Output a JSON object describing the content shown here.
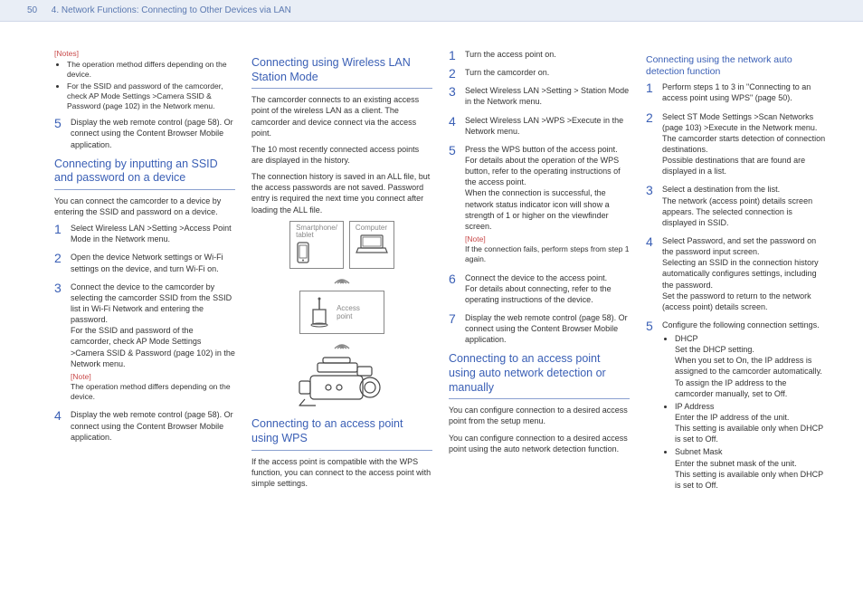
{
  "header": {
    "page_number": "50",
    "title": "4. Network Functions: Connecting to Other Devices via LAN"
  },
  "col1": {
    "notes_label": "[Notes]",
    "notes": [
      "The operation method differs depending on the device.",
      "For the SSID and password of the camcorder, check AP Mode Settings >Camera SSID & Password (page 102) in the Network menu."
    ],
    "step5_prefix": {
      "num": "5",
      "text": "Display the web remote control (page 58). Or connect using the Content Browser Mobile application."
    },
    "section_a_title": "Connecting by inputting an SSID and password on a device",
    "section_a_intro": "You can connect the camcorder to a device by entering the SSID and password on a device.",
    "section_a_steps": [
      {
        "num": "1",
        "text": "Select Wireless LAN >Setting >Access Point Mode in the Network menu."
      },
      {
        "num": "2",
        "text": "Open the device Network settings or Wi-Fi settings on the device, and turn Wi-Fi on."
      },
      {
        "num": "3",
        "text": "Connect the device to the camcorder by selecting the camcorder SSID from the SSID list in Wi-Fi Network and entering the password.\nFor the SSID and password of the camcorder, check AP Mode Settings >Camera SSID & Password (page 102) in the Network menu.",
        "note_label": "[Note]",
        "note": "The operation method differs depending on the device."
      },
      {
        "num": "4",
        "text": "Display the web remote control (page 58). Or connect using the Content Browser Mobile application."
      }
    ]
  },
  "col2": {
    "section_b_title": "Connecting using Wireless LAN Station Mode",
    "section_b_body1": "The camcorder connects to an existing access point of the wireless LAN as a client. The camcorder and device connect via the access point.",
    "section_b_body2": "The 10 most recently connected access points are displayed in the history.",
    "section_b_body3": "The connection history is saved in an ALL file, but the access passwords are not saved. Password entry is required the next time you connect after loading the ALL file.",
    "diagram": {
      "tablet_label": "Smartphone/\ntablet",
      "computer_label": "Computer",
      "ap_label": "Access\npoint"
    },
    "section_c_title": "Connecting to an access point using WPS",
    "section_c_body": "If the access point is compatible with the WPS function, you can connect to the access point with simple settings."
  },
  "col3": {
    "wps_steps": [
      {
        "num": "1",
        "text": "Turn the access point on."
      },
      {
        "num": "2",
        "text": "Turn the camcorder on."
      },
      {
        "num": "3",
        "text": "Select Wireless LAN >Setting > Station Mode in the Network menu."
      },
      {
        "num": "4",
        "text": "Select Wireless LAN >WPS >Execute in the Network menu."
      },
      {
        "num": "5",
        "text": "Press the WPS button of the access point.\nFor details about the operation of the WPS button, refer to the operating instructions of the access point.\nWhen the connection is successful, the network status indicator icon will show a strength of 1 or higher on the viewfinder screen.",
        "note_label": "[Note]",
        "note": "If the connection fails, perform steps from step 1 again."
      },
      {
        "num": "6",
        "text": "Connect the device to the access point.\nFor details about connecting, refer to the operating instructions of the device."
      },
      {
        "num": "7",
        "text": "Display the web remote control (page 58). Or connect using the Content Browser Mobile application."
      }
    ],
    "section_d_title": "Connecting to an access point using auto network detection or manually",
    "section_d_body1": "You can configure connection to a desired access point from the setup menu.",
    "section_d_body2": "You can configure connection to a desired access point using the auto network detection function."
  },
  "col4": {
    "section_e_title": "Connecting using the network auto detection function",
    "auto_steps": [
      {
        "num": "1",
        "text": "Perform steps 1 to 3 in \"Connecting to an access point using WPS\" (page 50)."
      },
      {
        "num": "2",
        "text": "Select ST Mode Settings >Scan Networks (page 103) >Execute in the Network menu.\nThe camcorder starts detection of connection destinations.\nPossible destinations that are found are displayed in a list."
      },
      {
        "num": "3",
        "text": "Select a destination from the list.\nThe network (access point) details screen appears. The selected connection is displayed in SSID."
      },
      {
        "num": "4",
        "text": "Select Password, and set the password on the password input screen.\nSelecting an SSID in the connection history automatically configures settings, including the password.\nSet the password to return to the network (access point) details screen."
      },
      {
        "num": "5",
        "text": "Configure the following connection settings.",
        "bullets": [
          {
            "title": "DHCP",
            "body": "Set the DHCP setting.\nWhen you set to On, the IP address is assigned to the camcorder automatically.\nTo assign the IP address to the camcorder manually, set to Off."
          },
          {
            "title": "IP Address",
            "body": "Enter the IP address of the unit.\nThis setting is available only when DHCP is set to Off."
          },
          {
            "title": "Subnet Mask",
            "body": "Enter the subnet mask of the unit.\nThis setting is available only when DHCP is set to Off."
          }
        ]
      }
    ]
  }
}
